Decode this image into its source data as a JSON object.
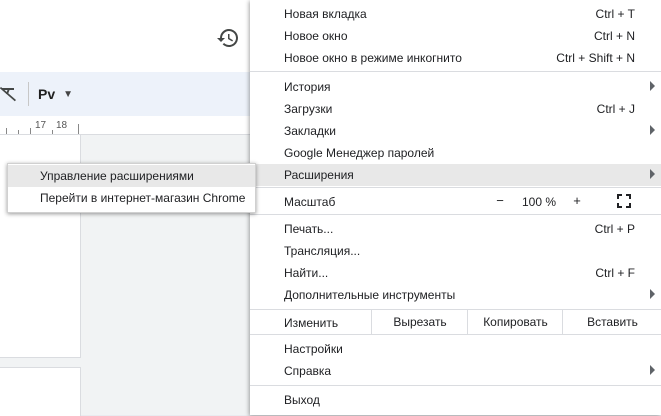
{
  "docs": {
    "style_select": "Рv",
    "ruler_numbers": [
      "17",
      "18"
    ]
  },
  "menu": {
    "new_tab": {
      "label": "Новая вкладка",
      "shortcut": "Ctrl + T"
    },
    "new_window": {
      "label": "Новое окно",
      "shortcut": "Ctrl + N"
    },
    "incognito": {
      "label": "Новое окно в режиме инкогнито",
      "shortcut": "Ctrl + Shift + N"
    },
    "history": {
      "label": "История"
    },
    "downloads": {
      "label": "Загрузки",
      "shortcut": "Ctrl + J"
    },
    "bookmarks": {
      "label": "Закладки"
    },
    "passwords": {
      "label": "Google Менеджер паролей"
    },
    "extensions": {
      "label": "Расширения"
    },
    "zoom": {
      "label": "Масштаб",
      "minus": "−",
      "value": "100 %",
      "plus": "+"
    },
    "print": {
      "label": "Печать...",
      "shortcut": "Ctrl + P"
    },
    "cast": {
      "label": "Трансляция..."
    },
    "find": {
      "label": "Найти...",
      "shortcut": "Ctrl + F"
    },
    "more_tools": {
      "label": "Дополнительные инструменты"
    },
    "edit": {
      "label": "Изменить",
      "cut": "Вырезать",
      "copy": "Копировать",
      "paste": "Вставить"
    },
    "settings": {
      "label": "Настройки"
    },
    "help": {
      "label": "Справка"
    },
    "exit": {
      "label": "Выход"
    }
  },
  "extensions_submenu": {
    "manage": "Управление расширениями",
    "webstore": "Перейти в интернет-магазин Chrome"
  },
  "colors": {
    "highlight": "#e8e8e8",
    "toolbar_bg": "#edf2fa"
  }
}
